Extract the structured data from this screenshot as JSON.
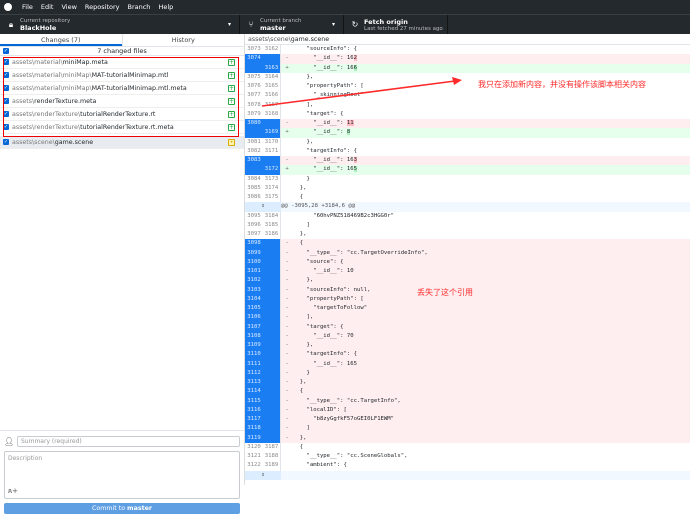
{
  "menu": [
    "File",
    "Edit",
    "View",
    "Repository",
    "Branch",
    "Help"
  ],
  "toolbar": {
    "repo": {
      "label": "Current repository",
      "value": "BlackHole"
    },
    "branch": {
      "label": "Current branch",
      "value": "master"
    },
    "fetch": {
      "label": "Fetch origin",
      "sub": "Last fetched 27 minutes ago"
    }
  },
  "tabs": {
    "changes": "Changes",
    "changes_count": "7",
    "history": "History"
  },
  "changed_files_label": "7 changed files",
  "files": [
    {
      "dir": "assets\\material\\",
      "name": "miniMap.meta",
      "status": "added"
    },
    {
      "dir": "assets\\material\\miniMap\\",
      "name": "MAT-tutorialMinimap.mtl",
      "status": "added"
    },
    {
      "dir": "assets\\material\\miniMap\\",
      "name": "MAT-tutorialMinimap.mtl.meta",
      "status": "added"
    },
    {
      "dir": "assets\\",
      "name": "renderTexture.meta",
      "status": "added"
    },
    {
      "dir": "assets\\renderTexture\\",
      "name": "tutorialRenderTexture.rt",
      "status": "added"
    },
    {
      "dir": "assets\\renderTexture\\",
      "name": "tutorialRenderTexture.rt.meta",
      "status": "added"
    },
    {
      "dir": "assets\\scene\\",
      "name": "game.scene",
      "status": "modified"
    }
  ],
  "commit": {
    "summary_placeholder": "Summary (required)",
    "description_placeholder": "Description",
    "button_prefix": "Commit to ",
    "button_branch": "master"
  },
  "diff": {
    "path_dir": "assets\\scene\\",
    "path_file": "game.scene",
    "lines": [
      {
        "t": "ctx",
        "o": "3073",
        "n": "3162",
        "c": "    \"sourceInfo\": {"
      },
      {
        "t": "del",
        "o": "3074",
        "n": "",
        "c": "      \"__id__\": 16",
        "h": "2"
      },
      {
        "t": "add",
        "o": "",
        "n": "3163",
        "c": "      \"__id__\": 16",
        "h": "6"
      },
      {
        "t": "ctx",
        "o": "3075",
        "n": "3164",
        "c": "    },"
      },
      {
        "t": "ctx",
        "o": "3076",
        "n": "3165",
        "c": "    \"propertyPath\": ["
      },
      {
        "t": "ctx",
        "o": "3077",
        "n": "3166",
        "c": "      \"_skinningRoot\""
      },
      {
        "t": "ctx",
        "o": "3078",
        "n": "3167",
        "c": "    ],"
      },
      {
        "t": "ctx",
        "o": "3079",
        "n": "3168",
        "c": "    \"target\": {"
      },
      {
        "t": "del",
        "o": "3080",
        "n": "",
        "c": "      \"__id__\": ",
        "h": "11"
      },
      {
        "t": "add",
        "o": "",
        "n": "3169",
        "c": "      \"__id__\": ",
        "h": "8"
      },
      {
        "t": "ctx",
        "o": "3081",
        "n": "3170",
        "c": "    },"
      },
      {
        "t": "ctx",
        "o": "3082",
        "n": "3171",
        "c": "    \"targetInfo\": {"
      },
      {
        "t": "del",
        "o": "3083",
        "n": "",
        "c": "      \"__id__\": 16",
        "h": "3"
      },
      {
        "t": "add",
        "o": "",
        "n": "3172",
        "c": "      \"__id__\": 16",
        "h": "5"
      },
      {
        "t": "ctx",
        "o": "3084",
        "n": "3173",
        "c": "    }"
      },
      {
        "t": "ctx",
        "o": "3085",
        "n": "3174",
        "c": "  },"
      },
      {
        "t": "ctx",
        "o": "3086",
        "n": "3175",
        "c": "  {"
      },
      {
        "t": "hunk",
        "c": "@@ -3095,28 +3184,6 @@"
      },
      {
        "t": "ctx",
        "o": "3095",
        "n": "3184",
        "c": "      \"60hvPNZ518469B2c3HGG0r\""
      },
      {
        "t": "ctx",
        "o": "3096",
        "n": "3185",
        "c": "    ]"
      },
      {
        "t": "ctx",
        "o": "3097",
        "n": "3186",
        "c": "  },"
      },
      {
        "t": "del",
        "o": "3098",
        "n": "",
        "c": "  {"
      },
      {
        "t": "del",
        "o": "3099",
        "n": "",
        "c": "    \"__type__\": \"cc.TargetOverrideInfo\","
      },
      {
        "t": "del",
        "o": "3100",
        "n": "",
        "c": "    \"source\": {"
      },
      {
        "t": "del",
        "o": "3101",
        "n": "",
        "c": "      \"__id__\": 10"
      },
      {
        "t": "del",
        "o": "3102",
        "n": "",
        "c": "    },"
      },
      {
        "t": "del",
        "o": "3103",
        "n": "",
        "c": "    \"sourceInfo\": null,"
      },
      {
        "t": "del",
        "o": "3104",
        "n": "",
        "c": "    \"propertyPath\": ["
      },
      {
        "t": "del",
        "o": "3105",
        "n": "",
        "c": "      \"targetToFollow\""
      },
      {
        "t": "del",
        "o": "3106",
        "n": "",
        "c": "    ],"
      },
      {
        "t": "del",
        "o": "3107",
        "n": "",
        "c": "    \"target\": {"
      },
      {
        "t": "del",
        "o": "3108",
        "n": "",
        "c": "      \"__id__\": 70"
      },
      {
        "t": "del",
        "o": "3109",
        "n": "",
        "c": "    },"
      },
      {
        "t": "del",
        "o": "3110",
        "n": "",
        "c": "    \"targetInfo\": {"
      },
      {
        "t": "del",
        "o": "3111",
        "n": "",
        "c": "      \"__id__\": 165"
      },
      {
        "t": "del",
        "o": "3112",
        "n": "",
        "c": "    }"
      },
      {
        "t": "del",
        "o": "3113",
        "n": "",
        "c": "  },"
      },
      {
        "t": "del",
        "o": "3114",
        "n": "",
        "c": "  {"
      },
      {
        "t": "del",
        "o": "3115",
        "n": "",
        "c": "    \"__type__\": \"cc.TargetInfo\","
      },
      {
        "t": "del",
        "o": "3116",
        "n": "",
        "c": "    \"localID\": ["
      },
      {
        "t": "del",
        "o": "3117",
        "n": "",
        "c": "      \"b8zyGgfkF57oGEI0LF1EWM\""
      },
      {
        "t": "del",
        "o": "3118",
        "n": "",
        "c": "    ]"
      },
      {
        "t": "del",
        "o": "3119",
        "n": "",
        "c": "  },"
      },
      {
        "t": "ctx",
        "o": "3120",
        "n": "3187",
        "c": "  {"
      },
      {
        "t": "ctx",
        "o": "3121",
        "n": "3188",
        "c": "    \"__type__\": \"cc.SceneGlobals\","
      },
      {
        "t": "ctx",
        "o": "3122",
        "n": "3189",
        "c": "    \"ambient\": {"
      },
      {
        "t": "hunk",
        "c": ""
      }
    ]
  },
  "annotations": {
    "note1": "我只在添加新内容，并没有操作该脚本相关内容",
    "note2": "丢失了这个引用",
    "color": "#ff2a2a"
  }
}
